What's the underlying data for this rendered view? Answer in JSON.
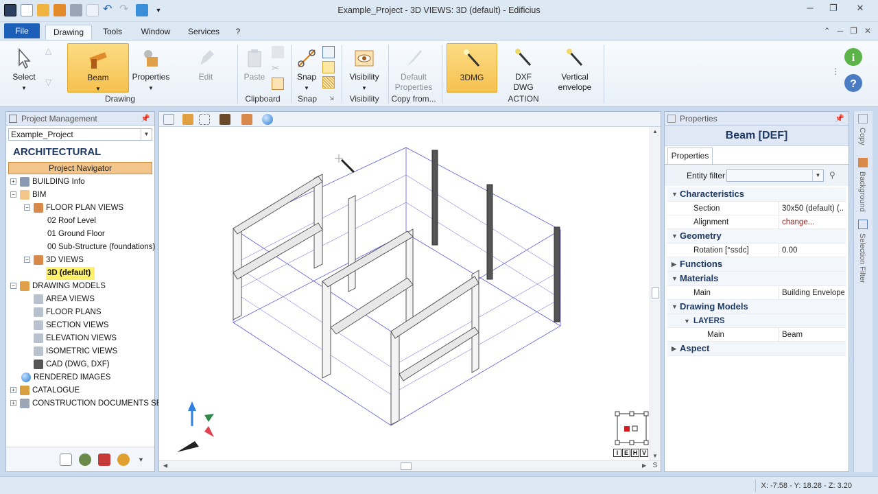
{
  "window": {
    "title": "Example_Project - 3D VIEWS: 3D (default) - Edificius"
  },
  "menu": {
    "file": "File",
    "tabs": [
      "Drawing",
      "Tools",
      "Window",
      "Services",
      "?"
    ]
  },
  "ribbon": {
    "select": "Select",
    "beam": "Beam",
    "properties": "Properties",
    "edit": "Edit",
    "paste": "Paste",
    "snap": "Snap",
    "visibility": "Visibility",
    "default_properties_1": "Default",
    "default_properties_2": "Properties",
    "threedmg": "3DMG",
    "dxf_1": "DXF",
    "dxf_2": "DWG",
    "vertical_1": "Vertical",
    "vertical_2": "envelope",
    "groups": {
      "drawing": "Drawing",
      "clipboard": "Clipboard",
      "snap": "Snap",
      "visibility": "Visibility",
      "copy_from": "Copy from...",
      "action": "ACTION"
    }
  },
  "project_panel": {
    "title": "Project Management",
    "project": "Example_Project",
    "heading": "ARCHITECTURAL",
    "navigator": "Project Navigator",
    "tree": {
      "building_info": "BUILDING Info",
      "bim": "BIM",
      "floor_plan_views": "FLOOR PLAN VIEWS",
      "roof": "02 Roof Level",
      "ground": "01 Ground Floor",
      "substructure": "00 Sub-Structure (foundations)",
      "views_3d": "3D VIEWS",
      "default_3d": "3D (default)",
      "drawing_models": "DRAWING MODELS",
      "area_views": "AREA VIEWS",
      "floor_plans": "FLOOR PLANS",
      "section_views": "SECTION VIEWS",
      "elevation_views": "ELEVATION VIEWS",
      "isometric_views": "ISOMETRIC VIEWS",
      "cad": "CAD (DWG, DXF)",
      "rendered": "RENDERED IMAGES",
      "catalogue": "CATALOGUE",
      "construction": "CONSTRUCTION DOCUMENTS SET"
    }
  },
  "viewcube_labels": [
    "I",
    "E",
    "H",
    "V"
  ],
  "scroll_label": "S",
  "properties_panel": {
    "title": "Properties",
    "element": "Beam [DEF]",
    "tab": "Properties",
    "entity_filter": "Entity filter",
    "characteristics": "Characteristics",
    "section_key": "Section",
    "section_val": "30x50 (default) (...",
    "alignment_key": "Alignment",
    "alignment_val": "change...",
    "geometry": "Geometry",
    "rotation_key": "Rotation [°ssdc]",
    "rotation_val": "0.00",
    "functions": "Functions",
    "materials": "Materials",
    "main_key": "Main",
    "main_val": "Building Envelope (",
    "drawing_models": "Drawing Models",
    "layers": "LAYERS",
    "layer_main_key": "Main",
    "layer_main_val": "Beam",
    "aspect": "Aspect"
  },
  "side_tabs": {
    "copy": "Copy",
    "background": "Background",
    "selection_filter": "Selection Filter"
  },
  "status": {
    "coords": "X: -7.58 - Y: 18.28 - Z: 3.20"
  },
  "colors": {
    "accent": "#1b5fb8",
    "highlight": "#f6c14f",
    "selected": "#fdf16b"
  }
}
